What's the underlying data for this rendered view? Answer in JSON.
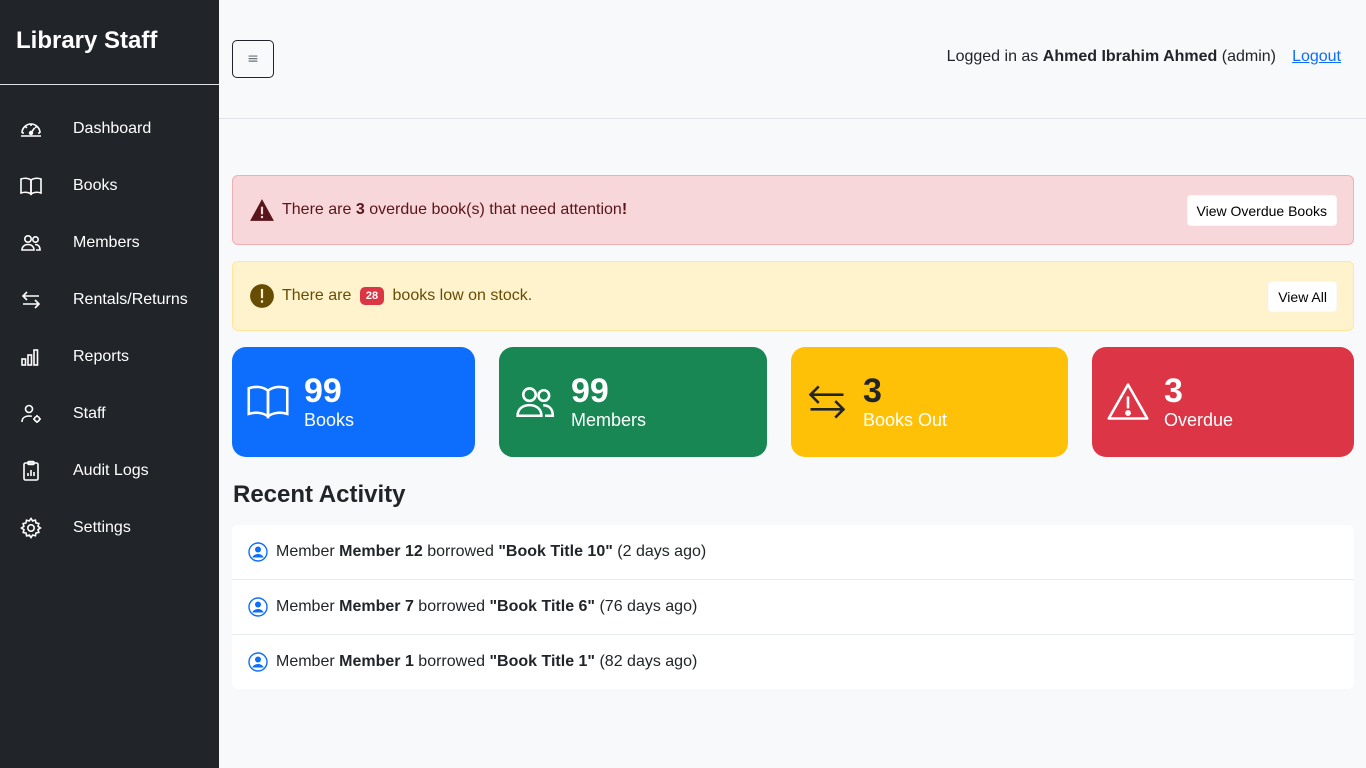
{
  "brand": "Library Staff",
  "nav": [
    {
      "label": "Dashboard",
      "icon": "speedometer-icon"
    },
    {
      "label": "Books",
      "icon": "book-icon"
    },
    {
      "label": "Members",
      "icon": "people-icon"
    },
    {
      "label": "Rentals/Returns",
      "icon": "arrows-exchange-icon"
    },
    {
      "label": "Reports",
      "icon": "bar-chart-icon"
    },
    {
      "label": "Staff",
      "icon": "person-gear-icon"
    },
    {
      "label": "Audit Logs",
      "icon": "clipboard-data-icon"
    },
    {
      "label": "Settings",
      "icon": "gear-icon"
    }
  ],
  "header": {
    "toggle_label": "≡",
    "logged_in_prefix": "Logged in as",
    "user_name": "Ahmed Ibrahim Ahmed",
    "user_role": "(admin)",
    "logout_label": "Logout"
  },
  "alerts": {
    "overdue": {
      "prefix": "There are",
      "count": "3",
      "suffix": "overdue book(s) that need attention",
      "exclaim": "!",
      "button": "View Overdue Books"
    },
    "low_stock": {
      "prefix": "There are",
      "count": "28",
      "suffix": "books low on stock.",
      "button": "View All"
    }
  },
  "stats": {
    "books": {
      "value": "99",
      "label": "Books"
    },
    "members": {
      "value": "99",
      "label": "Members"
    },
    "books_out": {
      "value": "3",
      "label": "Books Out"
    },
    "overdue": {
      "value": "3",
      "label": "Overdue"
    }
  },
  "recent_activity": {
    "title": "Recent Activity",
    "items": [
      {
        "prefix": "Member",
        "member": "Member 12",
        "action": "borrowed",
        "book": "\"Book Title 10\"",
        "when": "(2 days ago)"
      },
      {
        "prefix": "Member",
        "member": "Member 7",
        "action": "borrowed",
        "book": "\"Book Title 6\"",
        "when": "(76 days ago)"
      },
      {
        "prefix": "Member",
        "member": "Member 1",
        "action": "borrowed",
        "book": "\"Book Title 1\"",
        "when": "(82 days ago)"
      }
    ]
  },
  "colors": {
    "sidebar": "#212529",
    "primary": "#0d6efd",
    "success": "#198754",
    "warning": "#ffc107",
    "danger": "#dc3545"
  }
}
